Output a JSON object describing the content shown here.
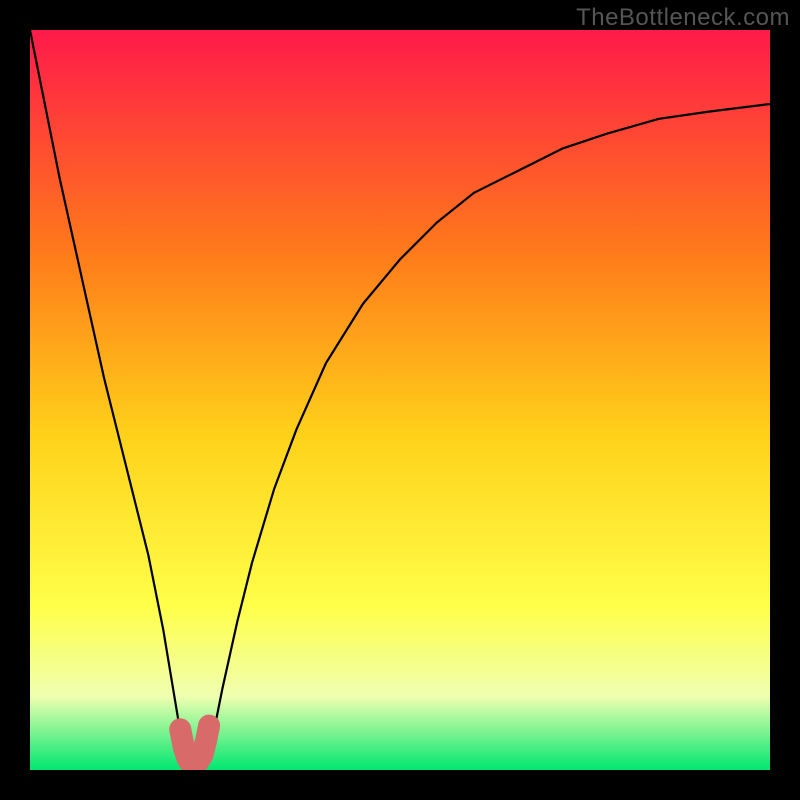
{
  "watermark": "TheBottleneck.com",
  "colors": {
    "frame_bg": "#000000",
    "gradient_top": "#ff1a4a",
    "gradient_mid1": "#ff7a1a",
    "gradient_mid2": "#ffd21a",
    "gradient_mid3": "#ffff4a",
    "gradient_mid4": "#f0ffb0",
    "gradient_bottom": "#00e770",
    "curve": "#000000",
    "accent": "#d96a6a"
  },
  "chart_data": {
    "type": "line",
    "title": "",
    "xlabel": "",
    "ylabel": "",
    "xlim": [
      0,
      100
    ],
    "ylim": [
      0,
      100
    ],
    "series": [
      {
        "name": "bottleneck-curve",
        "x": [
          0,
          2,
          4,
          6,
          8,
          10,
          12,
          14,
          16,
          18,
          19,
          20,
          21,
          22,
          23,
          24,
          25,
          26,
          28,
          30,
          33,
          36,
          40,
          45,
          50,
          55,
          60,
          66,
          72,
          78,
          85,
          92,
          100
        ],
        "values": [
          100,
          90,
          80,
          71,
          62,
          53,
          45,
          37,
          29,
          19,
          13,
          7,
          2,
          0,
          0,
          2,
          6,
          11,
          20,
          28,
          38,
          46,
          55,
          63,
          69,
          74,
          78,
          81,
          84,
          86,
          88,
          89,
          90
        ]
      },
      {
        "name": "highlight-segment",
        "x": [
          20.3,
          20.8,
          21.3,
          21.8,
          22.5,
          23.3,
          23.8,
          24.2
        ],
        "values": [
          5.5,
          3.0,
          1.5,
          0.8,
          0.8,
          2.0,
          4.0,
          6.0
        ]
      }
    ],
    "annotations": []
  }
}
